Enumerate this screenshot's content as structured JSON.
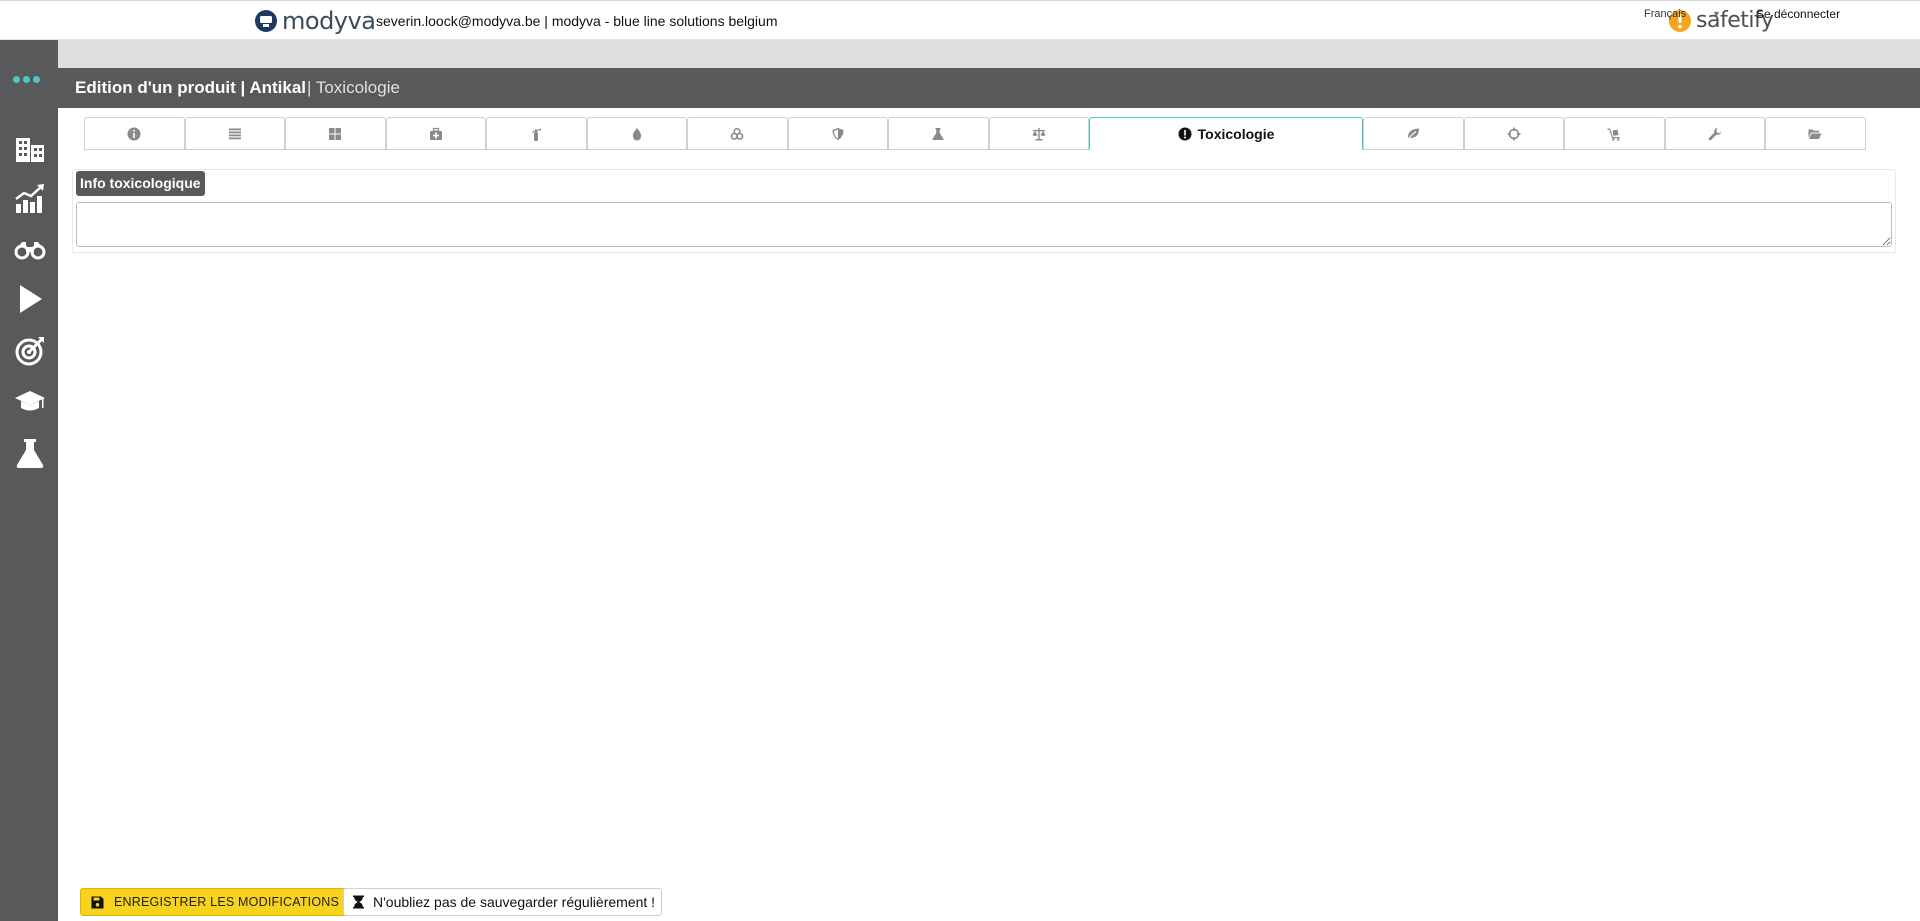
{
  "header": {
    "brand_name": "modyva",
    "user_info": "severin.loock@modyva.be | modyva - blue line solutions belgium",
    "partner_name": "safetify"
  },
  "topbar": {
    "language": "Français",
    "logout_label": "Se déconnecter"
  },
  "sidebar": {
    "items": [
      {
        "icon": "buildings-icon"
      },
      {
        "icon": "chart-growth-icon"
      },
      {
        "icon": "binoculars-icon"
      },
      {
        "icon": "play-icon"
      },
      {
        "icon": "target-icon"
      },
      {
        "icon": "graduation-cap-icon"
      },
      {
        "icon": "flask-icon"
      }
    ],
    "accent_color": "#4ec7c7"
  },
  "page": {
    "title": "Edition d'un produit | Antikal",
    "subtitle": "| Toxicologie"
  },
  "tabs": {
    "active_label": "Toxicologie",
    "icons": [
      "info-icon",
      "list-icon",
      "grid-icon",
      "first-aid-kit-icon",
      "fire-extinguisher-icon",
      "drop-icon",
      "biohazard-icon",
      "shield-icon",
      "flask-icon",
      "balance-icon",
      "exclamation-icon",
      "leaf-icon",
      "crosshair-icon",
      "cart-icon",
      "wrench-icon",
      "folder-open-icon"
    ]
  },
  "section": {
    "label": "Info toxicologique",
    "value": ""
  },
  "footer": {
    "save_label": "ENREGISTRER LES MODIFICATIONS",
    "reminder_label": "N'oubliez pas de sauvegarder régulièrement !",
    "save_color": "#f7d31d"
  }
}
